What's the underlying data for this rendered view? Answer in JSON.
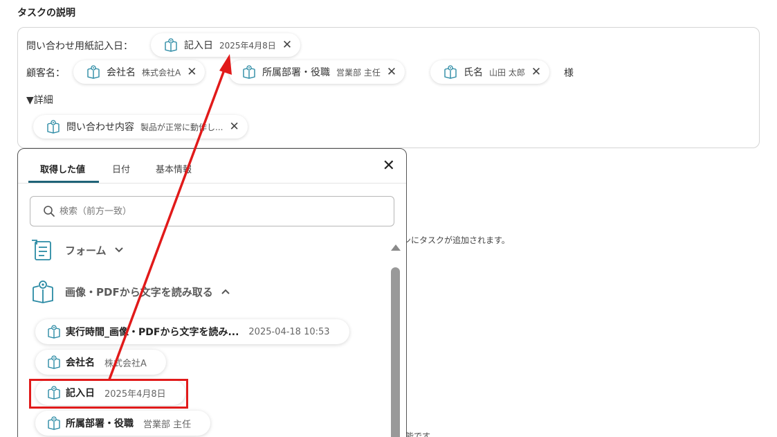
{
  "section": {
    "title": "タスクの説明"
  },
  "description": {
    "line1_label": "問い合わせ用紙記入日：",
    "line2_label": "顧客名：",
    "line2_suffix": "様",
    "line3_label": "▼詳細",
    "chips": {
      "date": {
        "name": "記入日",
        "value": "2025年4月8日"
      },
      "company": {
        "name": "会社名",
        "value": "株式会社A"
      },
      "dept": {
        "name": "所属部署・役職",
        "value": "営業部 主任"
      },
      "person": {
        "name": "氏名",
        "value": "山田 太郎"
      },
      "inquiry": {
        "name": "問い合わせ内容",
        "value": "製品が正常に動作し..."
      }
    },
    "remove_glyph": "✕"
  },
  "background_hints": {
    "hint1": "ンにタスクが追加されます。",
    "hint2": "能です。"
  },
  "picker": {
    "tabs": [
      {
        "label": "取得した値"
      },
      {
        "label": "日付"
      },
      {
        "label": "基本情報"
      }
    ],
    "close_glyph": "✕",
    "search": {
      "placeholder": "検索（前方一致）"
    },
    "groups": [
      {
        "title": "フォーム",
        "chevron": "⌄"
      },
      {
        "title": "画像・PDFから文字を読み取る",
        "chevron": "⌃"
      }
    ],
    "items": [
      {
        "name": "実行時間_画像・PDFから文字を読み...",
        "value": "2025-04-18 10:53"
      },
      {
        "name": "会社名",
        "value": "株式会社A"
      },
      {
        "name": "記入日",
        "value": "2025年4月8日"
      },
      {
        "name": "所属部署・役職",
        "value": "営業部 主任"
      }
    ]
  },
  "icons": {
    "value_chip_icon": "book-with-target-icon",
    "form_group_icon": "form-document-icon",
    "ocr_group_icon": "book-with-target-icon",
    "search_icon": "search-icon",
    "close_icon": "close-icon"
  },
  "colors": {
    "accent": "#1f6378",
    "icon_teal": "#2a8aa4",
    "annotation_red": "#e11a1a"
  }
}
